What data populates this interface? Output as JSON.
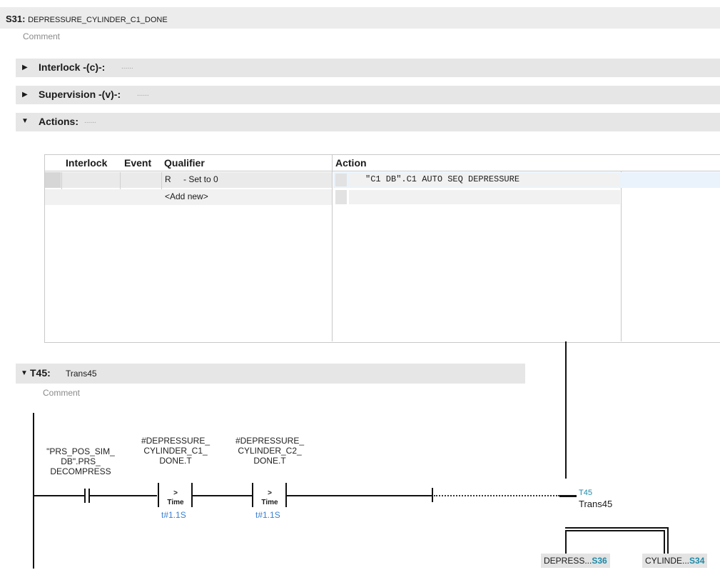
{
  "step": {
    "id": "S31:",
    "name": "DEPRESSURE_CYLINDER_C1_DONE",
    "comment": "Comment"
  },
  "sections": {
    "interlock": {
      "label": "Interlock -(c)-:",
      "dots": "......"
    },
    "supervision": {
      "label": "Supervision -(v)-:",
      "dots": "......"
    },
    "actions": {
      "label": "Actions:",
      "dots": "......"
    }
  },
  "actions_table": {
    "headers": [
      "Interlock",
      "Event",
      "Qualifier",
      "Action"
    ],
    "rows": [
      {
        "qualifier_code": "R",
        "qualifier_desc": "- Set to 0",
        "action": "\"C1 DB\".C1 AUTO SEQ DEPRESSURE"
      },
      {
        "qualifier_code": "",
        "qualifier_desc": "<Add new>",
        "action": ""
      }
    ]
  },
  "transition": {
    "id": "T45:",
    "name": "Trans45",
    "comment": "Comment"
  },
  "ladder": {
    "contact1": {
      "label": [
        "\"PRS_POS_SIM_",
        "DB\".PRS_",
        "DECOMPRESS"
      ]
    },
    "compare1": {
      "label": [
        "#DEPRESSURE_",
        "CYLINDER_C1_",
        "DONE.T"
      ],
      "op": ">",
      "type": "Time",
      "value": "t#1.1S"
    },
    "compare2": {
      "label": [
        "#DEPRESSURE_",
        "CYLINDER_C2_",
        "DONE.T"
      ],
      "op": ">",
      "type": "Time",
      "value": "t#1.1S"
    },
    "coil": {
      "id": "T45",
      "name": "Trans45"
    }
  },
  "targets": [
    {
      "name": "DEPRESS...",
      "step": "S36"
    },
    {
      "name": "CYLINDE...",
      "step": "S34"
    }
  ]
}
